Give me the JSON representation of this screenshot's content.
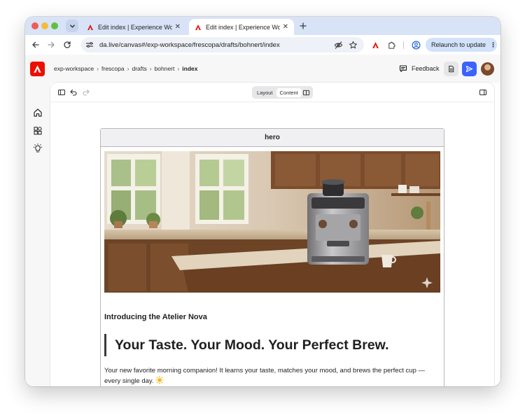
{
  "browser": {
    "tabs": [
      {
        "title": "Edit index | Experience Workspace",
        "active": false
      },
      {
        "title": "Edit index | Experience Workspace",
        "active": true
      }
    ],
    "address": {
      "url": "da.live/canvas#/exp-workspace/frescopa/drafts/bohnert/index"
    },
    "relaunch_label": "Relaunch to update",
    "traffic_colors": {
      "close": "#ee5d55",
      "minimize": "#f2bd3b",
      "zoom": "#5fc142"
    }
  },
  "app": {
    "brand_color": "#eb1000",
    "accent_color": "#3b63fb",
    "breadcrumb": [
      "exp-workspace",
      "frescopa",
      "drafts",
      "bohnert"
    ],
    "breadcrumb_current": "index",
    "feedback_label": "Feedback",
    "rail_icons": [
      "home-icon",
      "blocks-icon",
      "lightbulb-icon"
    ]
  },
  "editor": {
    "view_toggle": {
      "layout_label": "Layout",
      "content_label": "Content",
      "selected": "Content"
    },
    "block": {
      "name": "hero",
      "intro": "Introducing the Atelier Nova",
      "headline": "Your Taste. Your Mood. Your Perfect Brew.",
      "body": "Your new favorite morning companion! It learns your taste, matches your mood, and brews the perfect cup — every single day."
    }
  }
}
